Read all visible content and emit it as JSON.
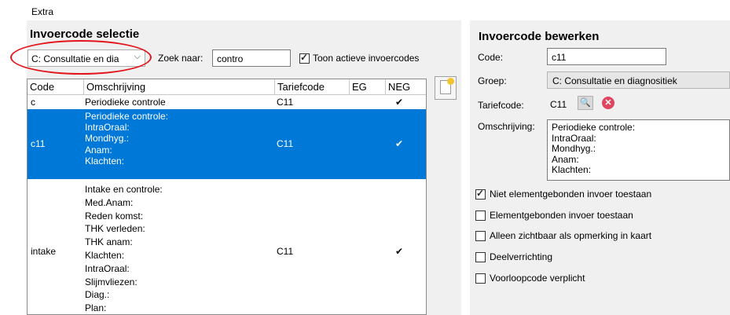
{
  "menu": {
    "extra": "Extra"
  },
  "left": {
    "title": "Invoercode selectie",
    "group_combo": "C: Consultatie en dia",
    "search_label": "Zoek naar:",
    "search_value": "contro",
    "active_checkbox_label": "Toon actieve invoercodes",
    "active_checked": true,
    "columns": [
      "Code",
      "Omschrijving",
      "Tariefcode",
      "EG",
      "NEG"
    ],
    "rows": [
      {
        "code": "c",
        "omschrijving": [
          "Periodieke controle"
        ],
        "tariefcode": "C11",
        "eg": "",
        "neg": "✔",
        "selected": false
      },
      {
        "code": "c11",
        "omschrijving": [
          "Periodieke controle:",
          "IntraOraal:",
          "Mondhyg.:",
          "Anam:",
          "Klachten:"
        ],
        "tariefcode": "C11",
        "eg": "",
        "neg": "✔",
        "selected": true
      },
      {
        "code": "intake",
        "omschrijving": [
          "Intake en controle:",
          "Med.Anam:",
          "Reden komst:",
          "THK verleden:",
          "THK anam:",
          "Klachten:",
          "IntraOraal:",
          "Slijmvliezen:",
          "Diag.:",
          "Plan:"
        ],
        "tariefcode": "C11",
        "eg": "",
        "neg": "✔",
        "selected": false
      }
    ]
  },
  "right": {
    "title": "Invoercode bewerken",
    "code_label": "Code:",
    "code_value": "c11",
    "groep_label": "Groep:",
    "groep_value": "C: Consultatie en diagnositiek",
    "tariefcode_label": "Tariefcode:",
    "tariefcode_value": "C11",
    "omschrijving_label": "Omschrijving:",
    "omschrijving_lines": [
      "Periodieke controle:",
      "IntraOraal:",
      "Mondhyg.:",
      "Anam:",
      "Klachten:"
    ],
    "checkboxes": [
      {
        "label": "Niet elementgebonden invoer toestaan",
        "checked": true
      },
      {
        "label": "Elementgebonden invoer toestaan",
        "checked": false
      },
      {
        "label": "Alleen zichtbaar als opmerking in kaart",
        "checked": false
      },
      {
        "label": "Deelverrichting",
        "checked": false
      },
      {
        "label": "Voorloopcode verplicht",
        "checked": false
      }
    ]
  },
  "colors": {
    "selection": "#0078d7",
    "highlight_ellipse": "#e3151c",
    "panel": "#f0f0f0"
  }
}
